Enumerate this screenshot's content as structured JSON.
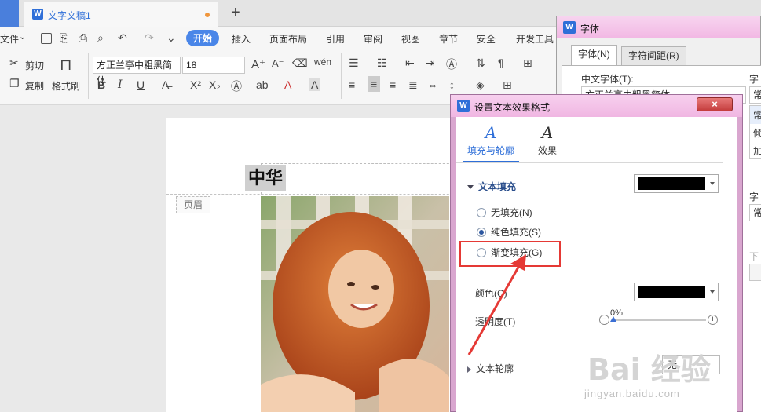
{
  "tabbar": {
    "doc_name": "文字文稿1",
    "add_label": "+"
  },
  "menubar": {
    "file_label": "文件",
    "items": [
      "开始",
      "插入",
      "页面布局",
      "引用",
      "审阅",
      "视图",
      "章节",
      "安全",
      "开发工具"
    ],
    "active": "开始"
  },
  "ribbon": {
    "cut_label": "剪切",
    "copy_label": "复制",
    "format_painter_label": "格式刷",
    "font_name": "方正兰亭中粗黑简体",
    "font_size": "18",
    "bold": "B",
    "italic": "I",
    "underline": "U"
  },
  "document": {
    "title_text": "中华",
    "header_tag": "页眉"
  },
  "font_dialog": {
    "title": "字体",
    "tabs": [
      "字体(N)",
      "字符间距(R)"
    ],
    "chinese_font_label": "中文字体(T):",
    "chinese_font_value": "方正兰亭中粗黑简体",
    "style_label": "字形",
    "style_items": [
      "常规",
      "常规",
      "倾斜",
      "加粗"
    ],
    "size_label": "字形",
    "size_value": "常规",
    "underline_label": "下划"
  },
  "effect_dialog": {
    "title": "设置文本效果格式",
    "close_label": "×",
    "tabs": [
      {
        "glyph": "A",
        "label": "填充与轮廓"
      },
      {
        "glyph": "A",
        "label": "效果"
      }
    ],
    "text_fill_section": "文本填充",
    "fill_options": [
      "无填充(N)",
      "纯色填充(S)",
      "渐变填充(G)"
    ],
    "selected_fill": 1,
    "color_label": "颜色(C)",
    "transparency_label": "透明度(T)",
    "transparency_value": "0%",
    "text_outline_section": "文本轮廓",
    "outline_value": "无",
    "fill_swatch_color": "#000000",
    "color_swatch_color": "#000000"
  },
  "watermark": {
    "brand": "Bai 经验",
    "url": "jingyan.baidu.com"
  },
  "colors": {
    "accent": "#4a86e8",
    "highlight": "#e53935",
    "dialog_title": "#f2b8e4"
  }
}
